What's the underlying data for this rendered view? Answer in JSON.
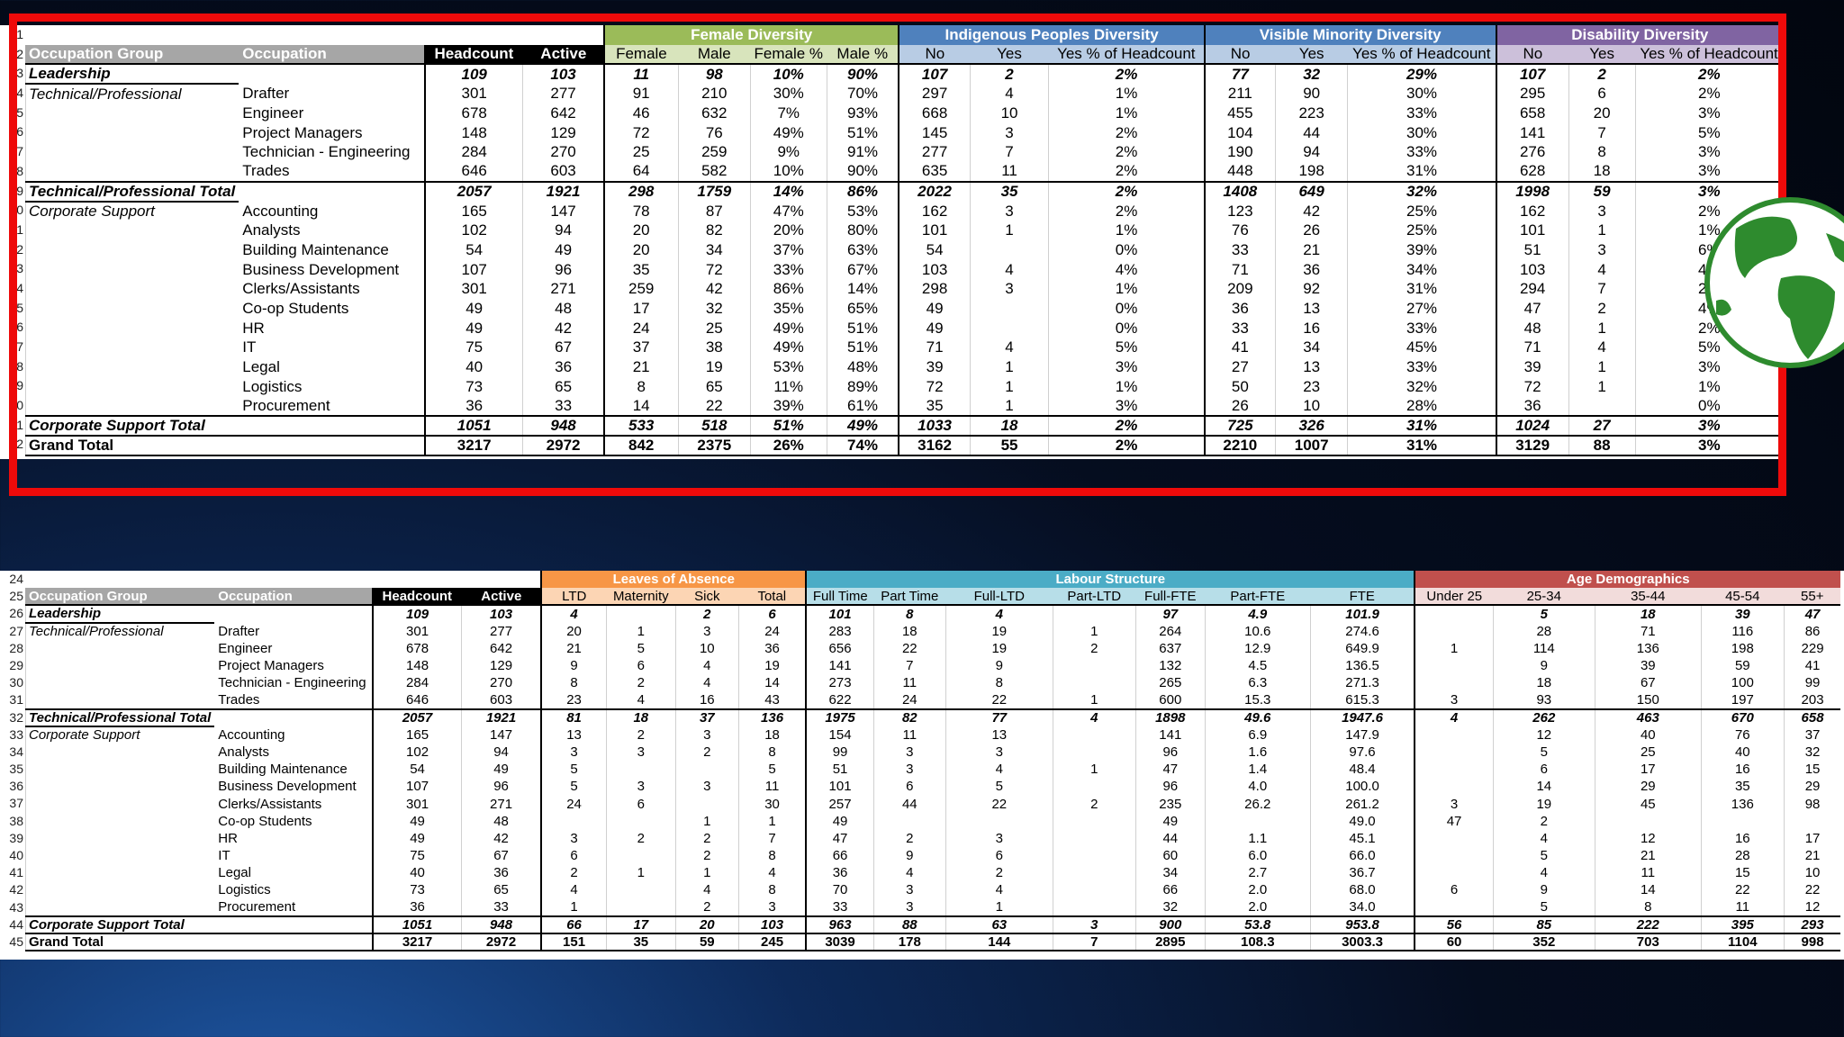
{
  "colors": {
    "female": "#9bbb59",
    "female_light": "#d8e4bc",
    "indig": "#4f81bd",
    "indig_light": "#b8cce4",
    "vis": "#4f81bd",
    "vis_light": "#b8cce4",
    "dis": "#8064a2",
    "dis_light": "#ccc0da",
    "loa": "#f79646",
    "loa_light": "#fcd5b4",
    "labour": "#4bacc6",
    "labour_light": "#b7dee8",
    "age": "#c0504d",
    "age_light": "#f2dcdb",
    "frame": "#ee0a0a"
  },
  "table1": {
    "row_numbers": [
      "1",
      "2",
      "3",
      "4",
      "5",
      "6",
      "7",
      "8",
      "9",
      "0",
      "1",
      "2",
      "3",
      "4",
      "5",
      "6",
      "7",
      "8",
      "9",
      "0",
      "1",
      "2"
    ],
    "group_headers": [
      {
        "label": "Female Diversity",
        "colspan": 4,
        "theme": "female"
      },
      {
        "label": "Indigenous Peoples Diversity",
        "colspan": 3,
        "theme": "indig"
      },
      {
        "label": "Visible Minority Diversity",
        "colspan": 3,
        "theme": "vis"
      },
      {
        "label": "Disability Diversity",
        "colspan": 3,
        "theme": "dis"
      }
    ],
    "base_headers": [
      "Occupation Group",
      "Occupation",
      "Headcount",
      "Active"
    ],
    "sub_headers": [
      {
        "label": "Female",
        "theme": "female"
      },
      {
        "label": "Male",
        "theme": "female"
      },
      {
        "label": "Female %",
        "theme": "female"
      },
      {
        "label": "Male %",
        "theme": "female"
      },
      {
        "label": "No",
        "theme": "indig"
      },
      {
        "label": "Yes",
        "theme": "indig"
      },
      {
        "label": "Yes % of Headcount",
        "theme": "indig"
      },
      {
        "label": "No",
        "theme": "vis"
      },
      {
        "label": "Yes",
        "theme": "vis"
      },
      {
        "label": "Yes % of Headcount",
        "theme": "vis"
      },
      {
        "label": "No",
        "theme": "dis"
      },
      {
        "label": "Yes",
        "theme": "dis"
      },
      {
        "label": "Yes % of Headcount",
        "theme": "dis"
      }
    ],
    "rows": [
      {
        "type": "total",
        "cells": [
          "Leadership",
          "",
          "109",
          "103",
          "11",
          "98",
          "10%",
          "90%",
          "107",
          "2",
          "2%",
          "77",
          "32",
          "29%",
          "107",
          "2",
          "2%"
        ]
      },
      {
        "type": "data",
        "cells": [
          "Technical/Professional",
          "Drafter",
          "301",
          "277",
          "91",
          "210",
          "30%",
          "70%",
          "297",
          "4",
          "1%",
          "211",
          "90",
          "30%",
          "295",
          "6",
          "2%"
        ]
      },
      {
        "type": "data",
        "cells": [
          "",
          "Engineer",
          "678",
          "642",
          "46",
          "632",
          "7%",
          "93%",
          "668",
          "10",
          "1%",
          "455",
          "223",
          "33%",
          "658",
          "20",
          "3%"
        ]
      },
      {
        "type": "data",
        "cells": [
          "",
          "Project Managers",
          "148",
          "129",
          "72",
          "76",
          "49%",
          "51%",
          "145",
          "3",
          "2%",
          "104",
          "44",
          "30%",
          "141",
          "7",
          "5%"
        ]
      },
      {
        "type": "data",
        "cells": [
          "",
          "Technician - Engineering",
          "284",
          "270",
          "25",
          "259",
          "9%",
          "91%",
          "277",
          "7",
          "2%",
          "190",
          "94",
          "33%",
          "276",
          "8",
          "3%"
        ]
      },
      {
        "type": "data",
        "cells": [
          "",
          "Trades",
          "646",
          "603",
          "64",
          "582",
          "10%",
          "90%",
          "635",
          "11",
          "2%",
          "448",
          "198",
          "31%",
          "628",
          "18",
          "3%"
        ]
      },
      {
        "type": "total",
        "cells": [
          "Technical/Professional Total",
          "",
          "2057",
          "1921",
          "298",
          "1759",
          "14%",
          "86%",
          "2022",
          "35",
          "2%",
          "1408",
          "649",
          "32%",
          "1998",
          "59",
          "3%"
        ]
      },
      {
        "type": "data",
        "cells": [
          "Corporate Support",
          "Accounting",
          "165",
          "147",
          "78",
          "87",
          "47%",
          "53%",
          "162",
          "3",
          "2%",
          "123",
          "42",
          "25%",
          "162",
          "3",
          "2%"
        ]
      },
      {
        "type": "data",
        "cells": [
          "",
          "Analysts",
          "102",
          "94",
          "20",
          "82",
          "20%",
          "80%",
          "101",
          "1",
          "1%",
          "76",
          "26",
          "25%",
          "101",
          "1",
          "1%"
        ]
      },
      {
        "type": "data",
        "cells": [
          "",
          "Building Maintenance",
          "54",
          "49",
          "20",
          "34",
          "37%",
          "63%",
          "54",
          "",
          "0%",
          "33",
          "21",
          "39%",
          "51",
          "3",
          "6%"
        ]
      },
      {
        "type": "data",
        "cells": [
          "",
          "Business Development",
          "107",
          "96",
          "35",
          "72",
          "33%",
          "67%",
          "103",
          "4",
          "4%",
          "71",
          "36",
          "34%",
          "103",
          "4",
          "4%"
        ]
      },
      {
        "type": "data",
        "cells": [
          "",
          "Clerks/Assistants",
          "301",
          "271",
          "259",
          "42",
          "86%",
          "14%",
          "298",
          "3",
          "1%",
          "209",
          "92",
          "31%",
          "294",
          "7",
          "2%"
        ]
      },
      {
        "type": "data",
        "cells": [
          "",
          "Co-op Students",
          "49",
          "48",
          "17",
          "32",
          "35%",
          "65%",
          "49",
          "",
          "0%",
          "36",
          "13",
          "27%",
          "47",
          "2",
          "4%"
        ]
      },
      {
        "type": "data",
        "cells": [
          "",
          "HR",
          "49",
          "42",
          "24",
          "25",
          "49%",
          "51%",
          "49",
          "",
          "0%",
          "33",
          "16",
          "33%",
          "48",
          "1",
          "2%"
        ]
      },
      {
        "type": "data",
        "cells": [
          "",
          "IT",
          "75",
          "67",
          "37",
          "38",
          "49%",
          "51%",
          "71",
          "4",
          "5%",
          "41",
          "34",
          "45%",
          "71",
          "4",
          "5%"
        ]
      },
      {
        "type": "data",
        "cells": [
          "",
          "Legal",
          "40",
          "36",
          "21",
          "19",
          "53%",
          "48%",
          "39",
          "1",
          "3%",
          "27",
          "13",
          "33%",
          "39",
          "1",
          "3%"
        ]
      },
      {
        "type": "data",
        "cells": [
          "",
          "Logistics",
          "73",
          "65",
          "8",
          "65",
          "11%",
          "89%",
          "72",
          "1",
          "1%",
          "50",
          "23",
          "32%",
          "72",
          "1",
          "1%"
        ]
      },
      {
        "type": "data",
        "cells": [
          "",
          "Procurement",
          "36",
          "33",
          "14",
          "22",
          "39%",
          "61%",
          "35",
          "1",
          "3%",
          "26",
          "10",
          "28%",
          "36",
          "",
          "0%"
        ]
      },
      {
        "type": "total",
        "cells": [
          "Corporate Support Total",
          "",
          "1051",
          "948",
          "533",
          "518",
          "51%",
          "49%",
          "1033",
          "18",
          "2%",
          "725",
          "326",
          "31%",
          "1024",
          "27",
          "3%"
        ]
      },
      {
        "type": "grand",
        "cells": [
          "Grand Total",
          "",
          "3217",
          "2972",
          "842",
          "2375",
          "26%",
          "74%",
          "3162",
          "55",
          "2%",
          "2210",
          "1007",
          "31%",
          "3129",
          "88",
          "3%"
        ]
      }
    ]
  },
  "table2": {
    "row_numbers": [
      "24",
      "25",
      "26",
      "27",
      "28",
      "29",
      "30",
      "31",
      "32",
      "33",
      "34",
      "35",
      "36",
      "37",
      "38",
      "39",
      "40",
      "41",
      "42",
      "43",
      "44",
      "45"
    ],
    "group_headers": [
      {
        "label": "Leaves of Absence",
        "colspan": 4,
        "theme": "loa"
      },
      {
        "label": "Labour Structure",
        "colspan": 7,
        "theme": "labour"
      },
      {
        "label": "Age Demographics",
        "colspan": 5,
        "theme": "age"
      }
    ],
    "base_headers": [
      "Occupation Group",
      "Occupation",
      "Headcount",
      "Active"
    ],
    "sub_headers": [
      {
        "label": "LTD",
        "theme": "loa"
      },
      {
        "label": "Maternity",
        "theme": "loa"
      },
      {
        "label": "Sick",
        "theme": "loa"
      },
      {
        "label": "Total",
        "theme": "loa"
      },
      {
        "label": "Full Time",
        "theme": "labour"
      },
      {
        "label": "Part Time",
        "theme": "labour"
      },
      {
        "label": "Full-LTD",
        "theme": "labour"
      },
      {
        "label": "Part-LTD",
        "theme": "labour"
      },
      {
        "label": "Full-FTE",
        "theme": "labour"
      },
      {
        "label": "Part-FTE",
        "theme": "labour"
      },
      {
        "label": "FTE",
        "theme": "labour"
      },
      {
        "label": "Under 25",
        "theme": "age"
      },
      {
        "label": "25-34",
        "theme": "age"
      },
      {
        "label": "35-44",
        "theme": "age"
      },
      {
        "label": "45-54",
        "theme": "age"
      },
      {
        "label": "55+",
        "theme": "age"
      }
    ],
    "rows": [
      {
        "type": "total",
        "cells": [
          "Leadership",
          "",
          "109",
          "103",
          "4",
          "",
          "2",
          "6",
          "101",
          "8",
          "4",
          "",
          "97",
          "4.9",
          "101.9",
          "",
          "5",
          "18",
          "39",
          "47"
        ]
      },
      {
        "type": "data",
        "cells": [
          "Technical/Professional",
          "Drafter",
          "301",
          "277",
          "20",
          "1",
          "3",
          "24",
          "283",
          "18",
          "19",
          "1",
          "264",
          "10.6",
          "274.6",
          "",
          "28",
          "71",
          "116",
          "86"
        ]
      },
      {
        "type": "data",
        "cells": [
          "",
          "Engineer",
          "678",
          "642",
          "21",
          "5",
          "10",
          "36",
          "656",
          "22",
          "19",
          "2",
          "637",
          "12.9",
          "649.9",
          "1",
          "114",
          "136",
          "198",
          "229"
        ]
      },
      {
        "type": "data",
        "cells": [
          "",
          "Project Managers",
          "148",
          "129",
          "9",
          "6",
          "4",
          "19",
          "141",
          "7",
          "9",
          "",
          "132",
          "4.5",
          "136.5",
          "",
          "9",
          "39",
          "59",
          "41"
        ]
      },
      {
        "type": "data",
        "cells": [
          "",
          "Technician - Engineering",
          "284",
          "270",
          "8",
          "2",
          "4",
          "14",
          "273",
          "11",
          "8",
          "",
          "265",
          "6.3",
          "271.3",
          "",
          "18",
          "67",
          "100",
          "99"
        ]
      },
      {
        "type": "data",
        "cells": [
          "",
          "Trades",
          "646",
          "603",
          "23",
          "4",
          "16",
          "43",
          "622",
          "24",
          "22",
          "1",
          "600",
          "15.3",
          "615.3",
          "3",
          "93",
          "150",
          "197",
          "203"
        ]
      },
      {
        "type": "total",
        "cells": [
          "Technical/Professional Total",
          "",
          "2057",
          "1921",
          "81",
          "18",
          "37",
          "136",
          "1975",
          "82",
          "77",
          "4",
          "1898",
          "49.6",
          "1947.6",
          "4",
          "262",
          "463",
          "670",
          "658"
        ]
      },
      {
        "type": "data",
        "cells": [
          "Corporate Support",
          "Accounting",
          "165",
          "147",
          "13",
          "2",
          "3",
          "18",
          "154",
          "11",
          "13",
          "",
          "141",
          "6.9",
          "147.9",
          "",
          "12",
          "40",
          "76",
          "37"
        ]
      },
      {
        "type": "data",
        "cells": [
          "",
          "Analysts",
          "102",
          "94",
          "3",
          "3",
          "2",
          "8",
          "99",
          "3",
          "3",
          "",
          "96",
          "1.6",
          "97.6",
          "",
          "5",
          "25",
          "40",
          "32"
        ]
      },
      {
        "type": "data",
        "cells": [
          "",
          "Building Maintenance",
          "54",
          "49",
          "5",
          "",
          "",
          "5",
          "51",
          "3",
          "4",
          "1",
          "47",
          "1.4",
          "48.4",
          "",
          "6",
          "17",
          "16",
          "15"
        ]
      },
      {
        "type": "data",
        "cells": [
          "",
          "Business Development",
          "107",
          "96",
          "5",
          "3",
          "3",
          "11",
          "101",
          "6",
          "5",
          "",
          "96",
          "4.0",
          "100.0",
          "",
          "14",
          "29",
          "35",
          "29"
        ]
      },
      {
        "type": "data",
        "cells": [
          "",
          "Clerks/Assistants",
          "301",
          "271",
          "24",
          "6",
          "",
          "30",
          "257",
          "44",
          "22",
          "2",
          "235",
          "26.2",
          "261.2",
          "3",
          "19",
          "45",
          "136",
          "98"
        ]
      },
      {
        "type": "data",
        "cells": [
          "",
          "Co-op Students",
          "49",
          "48",
          "",
          "",
          "1",
          "1",
          "49",
          "",
          "",
          "",
          "49",
          "",
          "49.0",
          "47",
          "2",
          "",
          "",
          ""
        ]
      },
      {
        "type": "data",
        "cells": [
          "",
          "HR",
          "49",
          "42",
          "3",
          "2",
          "2",
          "7",
          "47",
          "2",
          "3",
          "",
          "44",
          "1.1",
          "45.1",
          "",
          "4",
          "12",
          "16",
          "17"
        ]
      },
      {
        "type": "data",
        "cells": [
          "",
          "IT",
          "75",
          "67",
          "6",
          "",
          "2",
          "8",
          "66",
          "9",
          "6",
          "",
          "60",
          "6.0",
          "66.0",
          "",
          "5",
          "21",
          "28",
          "21"
        ]
      },
      {
        "type": "data",
        "cells": [
          "",
          "Legal",
          "40",
          "36",
          "2",
          "1",
          "1",
          "4",
          "36",
          "4",
          "2",
          "",
          "34",
          "2.7",
          "36.7",
          "",
          "4",
          "11",
          "15",
          "10"
        ]
      },
      {
        "type": "data",
        "cells": [
          "",
          "Logistics",
          "73",
          "65",
          "4",
          "",
          "4",
          "8",
          "70",
          "3",
          "4",
          "",
          "66",
          "2.0",
          "68.0",
          "6",
          "9",
          "14",
          "22",
          "22"
        ]
      },
      {
        "type": "data",
        "cells": [
          "",
          "Procurement",
          "36",
          "33",
          "1",
          "",
          "2",
          "3",
          "33",
          "3",
          "1",
          "",
          "32",
          "2.0",
          "34.0",
          "",
          "5",
          "8",
          "11",
          "12"
        ]
      },
      {
        "type": "total",
        "cells": [
          "Corporate Support Total",
          "",
          "1051",
          "948",
          "66",
          "17",
          "20",
          "103",
          "963",
          "88",
          "63",
          "3",
          "900",
          "53.8",
          "953.8",
          "56",
          "85",
          "222",
          "395",
          "293"
        ]
      },
      {
        "type": "grand",
        "cells": [
          "Grand Total",
          "",
          "3217",
          "2972",
          "151",
          "35",
          "59",
          "245",
          "3039",
          "178",
          "144",
          "7",
          "2895",
          "108.3",
          "3003.3",
          "60",
          "352",
          "703",
          "1104",
          "998"
        ]
      }
    ]
  },
  "decor": {
    "globe_icon": "globe-icon"
  }
}
